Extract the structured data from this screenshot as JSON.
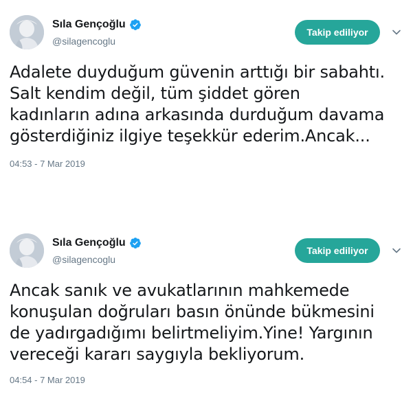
{
  "tweets": [
    {
      "display_name": "Sıla Gençoğlu",
      "handle": "@silagencoglu",
      "follow_label": "Takip ediliyor",
      "text_lines": [
        "Adalete duyduğum güvenin arttığı bir sabahtı.",
        "Salt kendim değil, tüm şiddet gören",
        "kadınların adına arkasında durduğum davama",
        "gösterdiğiniz ilgiye teşekkür ederim.Ancak..."
      ],
      "timestamp": "04:53 - 7 Mar 2019"
    },
    {
      "display_name": "Sıla Gençoğlu",
      "handle": "@silagencoglu",
      "follow_label": "Takip ediliyor",
      "text_lines": [
        "Ancak sanık ve avukatlarının mahkemede",
        "konuşulan doğruları basın önünde bükmesini",
        "de yadırgadığımı belirtmeliyim.Yine! Yargının",
        "vereceği kararı saygıyla bekliyorum."
      ],
      "timestamp": "04:54 - 7 Mar 2019"
    }
  ],
  "colors": {
    "follow_button": "#26a69a",
    "verified_badge": "#1da1f2",
    "secondary_text": "#657786",
    "primary_text": "#14171a"
  },
  "icons": {
    "verified": "verified-badge-icon",
    "menu": "chevron-down-icon"
  }
}
